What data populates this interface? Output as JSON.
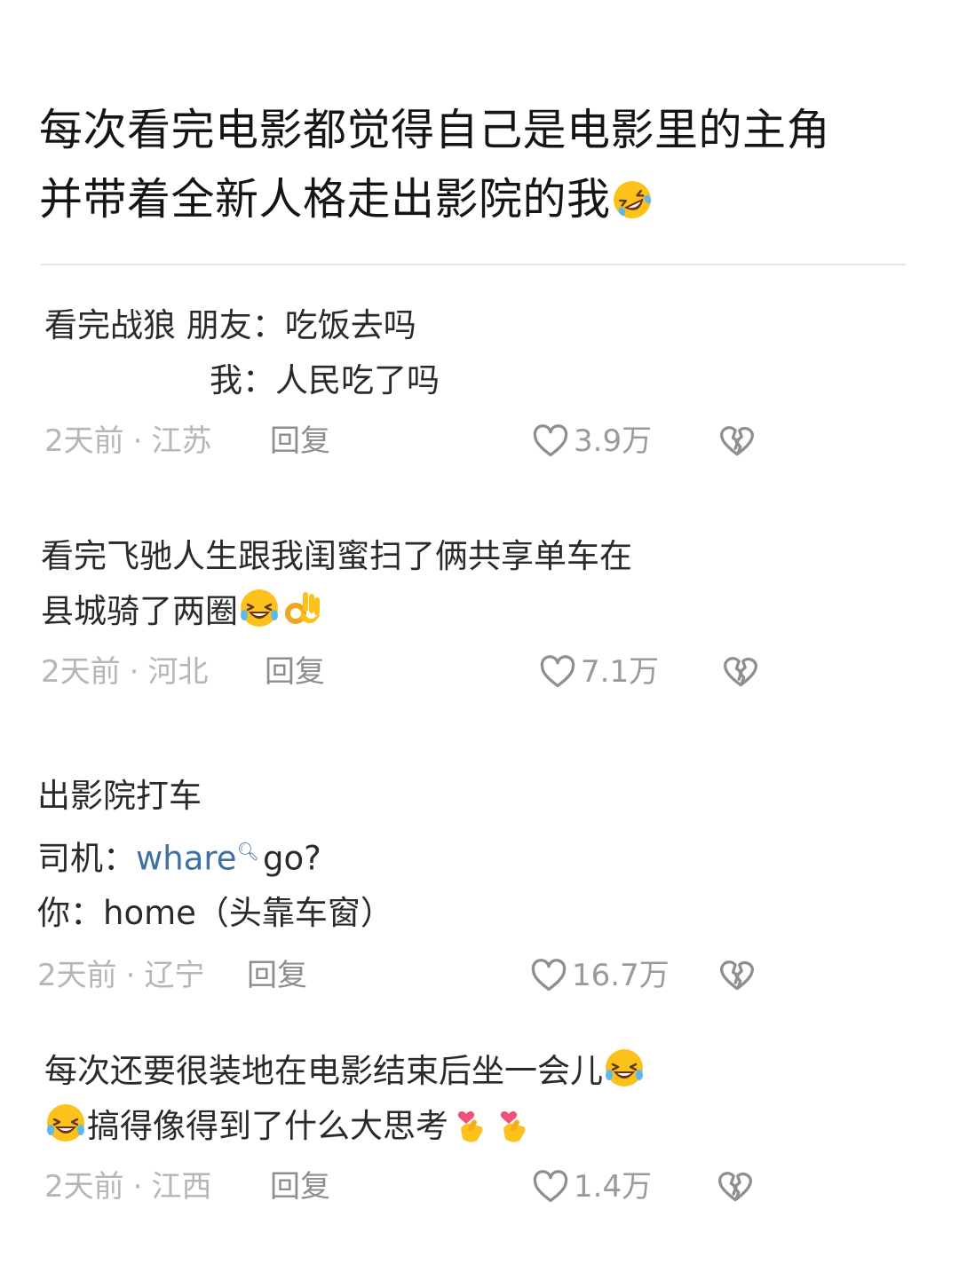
{
  "post": {
    "title_line1": "每次看完电影都觉得自己是电影里的主角",
    "title_line2": "并带着全新人格走出影院的我",
    "title_emoji": "rolling-laughing-emoji"
  },
  "comments": [
    {
      "lines": [
        "看完战狼 朋友：吃饭去吗",
        "我：人民吃了吗"
      ],
      "time": "2天前",
      "region": "江苏",
      "reply_label": "回复",
      "likes": "3.9万"
    },
    {
      "lines": [
        "看完飞驰人生跟我闺蜜扫了俩共享单车在",
        "县城骑了两圈"
      ],
      "emojis": [
        "laughing-tears-emoji",
        "ok-hand-emoji"
      ],
      "time": "2天前",
      "region": "河北",
      "reply_label": "回复",
      "likes": "7.1万"
    },
    {
      "lines": [
        "出影院打车",
        "司机：",
        "go?",
        "你：home（头靠车窗）"
      ],
      "link_word": "whare",
      "time": "2天前",
      "region": "辽宁",
      "reply_label": "回复",
      "likes": "16.7万"
    },
    {
      "lines": [
        "每次还要很装地在电影结束后坐一会儿",
        "搞得像得到了什么大思考"
      ],
      "emojis": [
        "laughing-tears-emoji",
        "laughing-tears-emoji",
        "finger-heart-emoji",
        "finger-heart-emoji"
      ],
      "time": "2天前",
      "region": "江西",
      "reply_label": "回复",
      "likes": "1.4万"
    }
  ],
  "meta_separator": "·",
  "colors": {
    "text": "#2a2a2a",
    "meta_gray": "#b6b6b6",
    "link_blue": "#3f6fa4"
  }
}
